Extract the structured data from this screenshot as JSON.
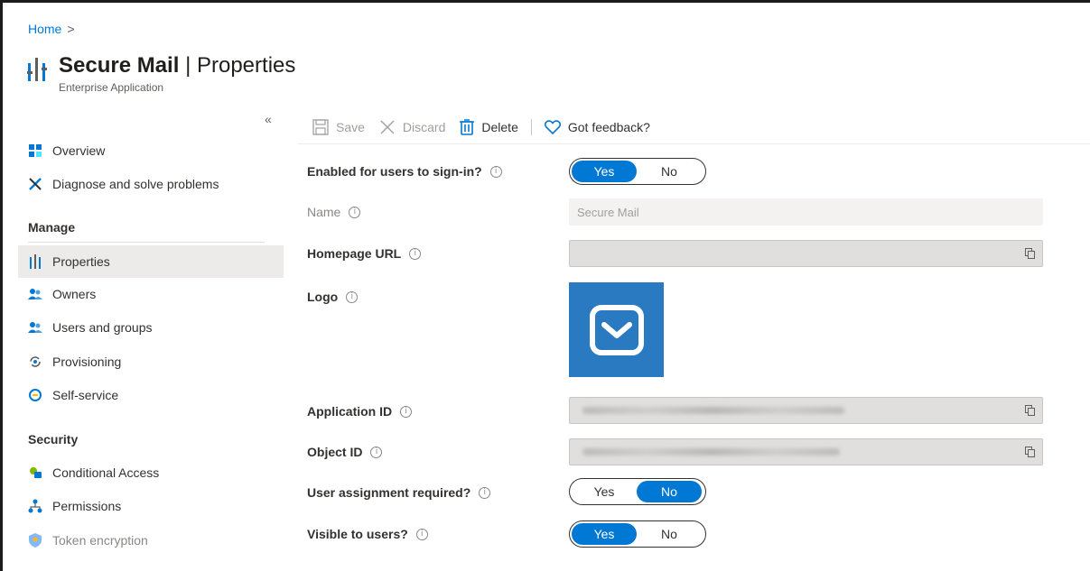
{
  "breadcrumb": {
    "home": "Home",
    "separator": ">"
  },
  "header": {
    "app_name": "Secure Mail",
    "divider": "|",
    "page": "Properties",
    "subtitle": "Enterprise Application"
  },
  "sidebar": {
    "collapse_glyph": "«",
    "items_top": [
      {
        "label": "Overview",
        "icon": "grid-icon"
      },
      {
        "label": "Diagnose and solve problems",
        "icon": "wrench-icon"
      }
    ],
    "manage_label": "Manage",
    "manage_items": [
      {
        "label": "Properties",
        "icon": "properties-icon",
        "active": true
      },
      {
        "label": "Owners",
        "icon": "people-icon"
      },
      {
        "label": "Users and groups",
        "icon": "people-icon"
      },
      {
        "label": "Provisioning",
        "icon": "sync-icon"
      },
      {
        "label": "Self-service",
        "icon": "self-service-icon"
      }
    ],
    "security_label": "Security",
    "security_items": [
      {
        "label": "Conditional Access",
        "icon": "conditional-access-icon"
      },
      {
        "label": "Permissions",
        "icon": "permissions-icon"
      },
      {
        "label": "Token encryption",
        "icon": "shield-icon",
        "disabled": true
      }
    ]
  },
  "toolbar": {
    "save": "Save",
    "discard": "Discard",
    "delete": "Delete",
    "feedback": "Got feedback?"
  },
  "form": {
    "enabled_label": "Enabled for users to sign-in?",
    "enabled_yes": "Yes",
    "enabled_no": "No",
    "enabled_value": "Yes",
    "name_label": "Name",
    "name_value": "Secure Mail",
    "homepage_label": "Homepage URL",
    "homepage_value": "",
    "logo_label": "Logo",
    "app_id_label": "Application ID",
    "object_id_label": "Object ID",
    "assignment_label": "User assignment required?",
    "assignment_yes": "Yes",
    "assignment_no": "No",
    "assignment_value": "No",
    "visible_label": "Visible to users?",
    "visible_yes": "Yes",
    "visible_no": "No",
    "visible_value": "Yes"
  },
  "colors": {
    "accent": "#0078d4",
    "logo_bg": "#2a7ac1"
  }
}
